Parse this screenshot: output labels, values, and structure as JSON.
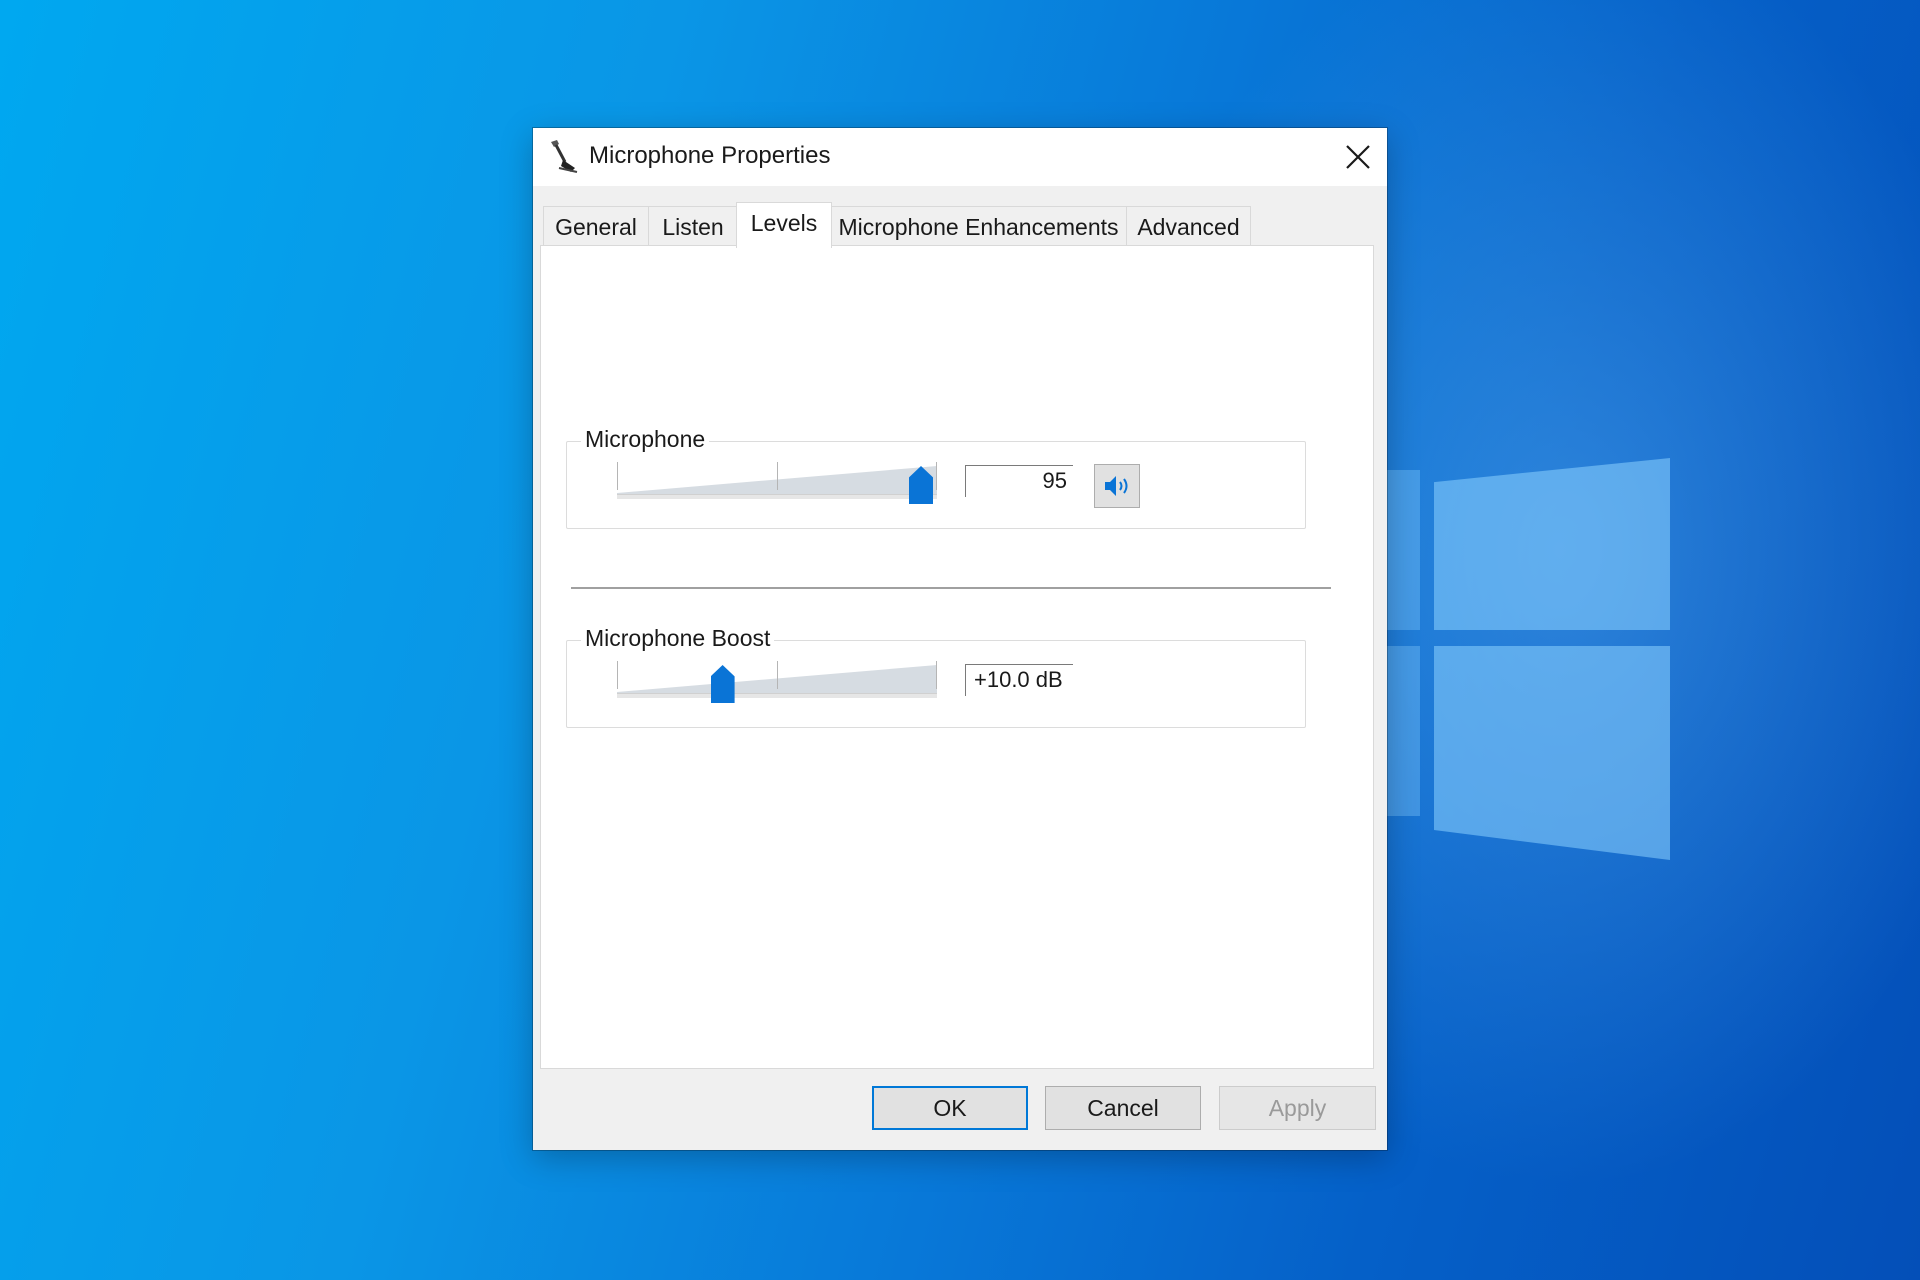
{
  "dialog": {
    "title": "Microphone Properties",
    "close_label": "✕"
  },
  "tabs": [
    {
      "label": "General",
      "active": false
    },
    {
      "label": "Listen",
      "active": false
    },
    {
      "label": "Levels",
      "active": true
    },
    {
      "label": "Microphone Enhancements",
      "active": false
    },
    {
      "label": "Advanced",
      "active": false
    }
  ],
  "levels": {
    "microphone": {
      "label": "Microphone",
      "value": "95",
      "slider_fraction": 0.95,
      "mute_icon": "speaker-icon"
    },
    "boost": {
      "label": "Microphone Boost",
      "value": "+10.0 dB",
      "slider_fraction": 0.33
    }
  },
  "buttons": {
    "ok": "OK",
    "cancel": "Cancel",
    "apply": "Apply"
  },
  "colors": {
    "accent": "#0078d7",
    "thumb": "#0a74d6"
  }
}
